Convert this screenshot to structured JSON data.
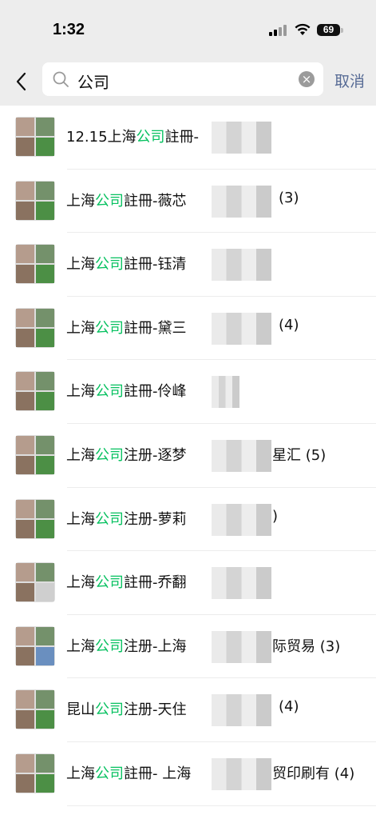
{
  "status_bar": {
    "time": "1:32",
    "battery": "69"
  },
  "search": {
    "query": "公司",
    "cancel_label": "取消"
  },
  "results": [
    {
      "before": "12.15上海",
      "highlight": "公司",
      "after": "註冊-",
      "suffix": ""
    },
    {
      "before": "上海",
      "highlight": "公司",
      "after": "註冊-薇芯",
      "suffix": "(3)"
    },
    {
      "before": "上海",
      "highlight": "公司",
      "after": "註冊-钰清",
      "suffix": ""
    },
    {
      "before": "上海",
      "highlight": "公司",
      "after": "註冊-黛三",
      "suffix": "(4)"
    },
    {
      "before": "上海",
      "highlight": "公司",
      "after": "註冊-伶峰",
      "suffix": ""
    },
    {
      "before": "上海",
      "highlight": "公司",
      "after": "注册-逐梦",
      "suffix": "星汇 (5)"
    },
    {
      "before": "上海",
      "highlight": "公司",
      "after": "注册-萝莉",
      "suffix": ")"
    },
    {
      "before": "上海",
      "highlight": "公司",
      "after": "註冊-乔翻",
      "suffix": ""
    },
    {
      "before": "上海",
      "highlight": "公司",
      "after": "注册-上海",
      "suffix": "际贸易 (3)"
    },
    {
      "before": "昆山",
      "highlight": "公司",
      "after": "注册-天住",
      "suffix": "(4)"
    },
    {
      "before": "上海",
      "highlight": "公司",
      "after": "註冊- 上海",
      "suffix": "贸印刷有 (4)"
    }
  ]
}
